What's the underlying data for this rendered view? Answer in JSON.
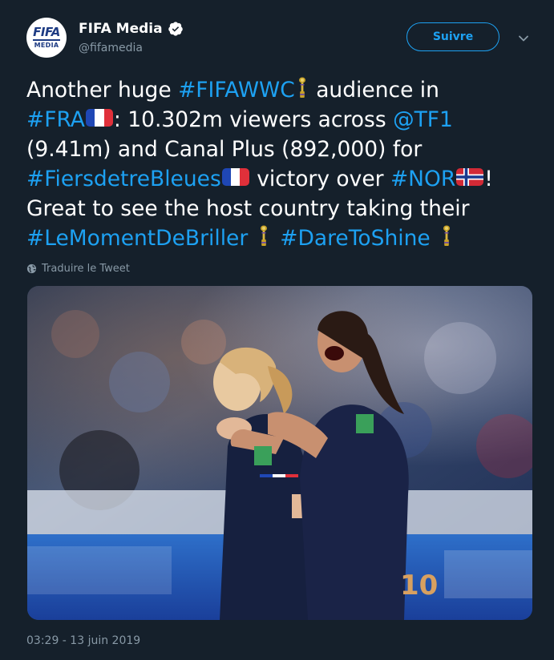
{
  "account": {
    "avatar_line1": "FIFA",
    "avatar_line2": "MEDIA",
    "display_name": "FIFA Media",
    "handle": "@fifamedia"
  },
  "actions": {
    "follow_label": "Suivre"
  },
  "tweet": {
    "segments": [
      {
        "text": "Another huge ",
        "type": "text"
      },
      {
        "text": "#FIFAWWC",
        "type": "hashtag"
      },
      {
        "emoji": "trophy-emoji"
      },
      {
        "text": " audience in",
        "type": "text"
      },
      {
        "text": "#FRA",
        "type": "hashtag"
      },
      {
        "emoji": "france-flag-emoji"
      },
      {
        "text": ": 10.302m viewers across ",
        "type": "text"
      },
      {
        "text": "@TF1",
        "type": "mention"
      },
      {
        "text": "(9.41m) and Canal Plus (892,000) for",
        "type": "text"
      },
      {
        "text": "#FiersdetreBleues",
        "type": "hashtag"
      },
      {
        "emoji": "france-flag-emoji"
      },
      {
        "text": " victory over ",
        "type": "text"
      },
      {
        "text": "#NOR",
        "type": "hashtag"
      },
      {
        "emoji": "norway-flag-emoji"
      },
      {
        "text": "!",
        "type": "text"
      },
      {
        "text": "Great to see the host country taking their",
        "type": "text"
      },
      {
        "text": "#LeMomentDeBriller",
        "type": "hashtag"
      },
      {
        "emoji": "trophy-emoji"
      },
      {
        "text": "#DareToShine",
        "type": "hashtag"
      },
      {
        "emoji": "trophy-emoji"
      }
    ],
    "translate_label": "Traduire le Tweet",
    "timestamp": "03:29 - 13 juin 2019",
    "media_number": "10"
  },
  "colors": {
    "background": "#15202b",
    "link": "#1da1f2",
    "muted": "#8899a6",
    "verified": "#ffffff"
  }
}
